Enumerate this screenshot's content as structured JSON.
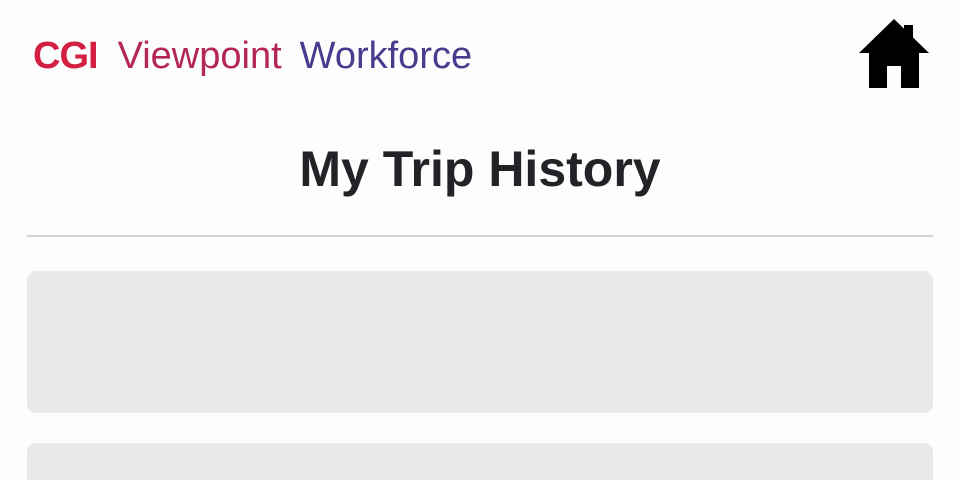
{
  "header": {
    "logo": {
      "brand": "CGI",
      "product_primary": "Viewpoint",
      "product_secondary": "Workforce"
    },
    "home_button": {
      "icon": "home-icon"
    }
  },
  "main": {
    "title": "My Trip History",
    "trips": []
  },
  "colors": {
    "brand_red": "#d31f42",
    "brand_magenta": "#b32655",
    "brand_purple": "#4a3b8f",
    "title_text": "#222326",
    "card_background": "#e9eaec",
    "divider": "#d3d4d6"
  }
}
